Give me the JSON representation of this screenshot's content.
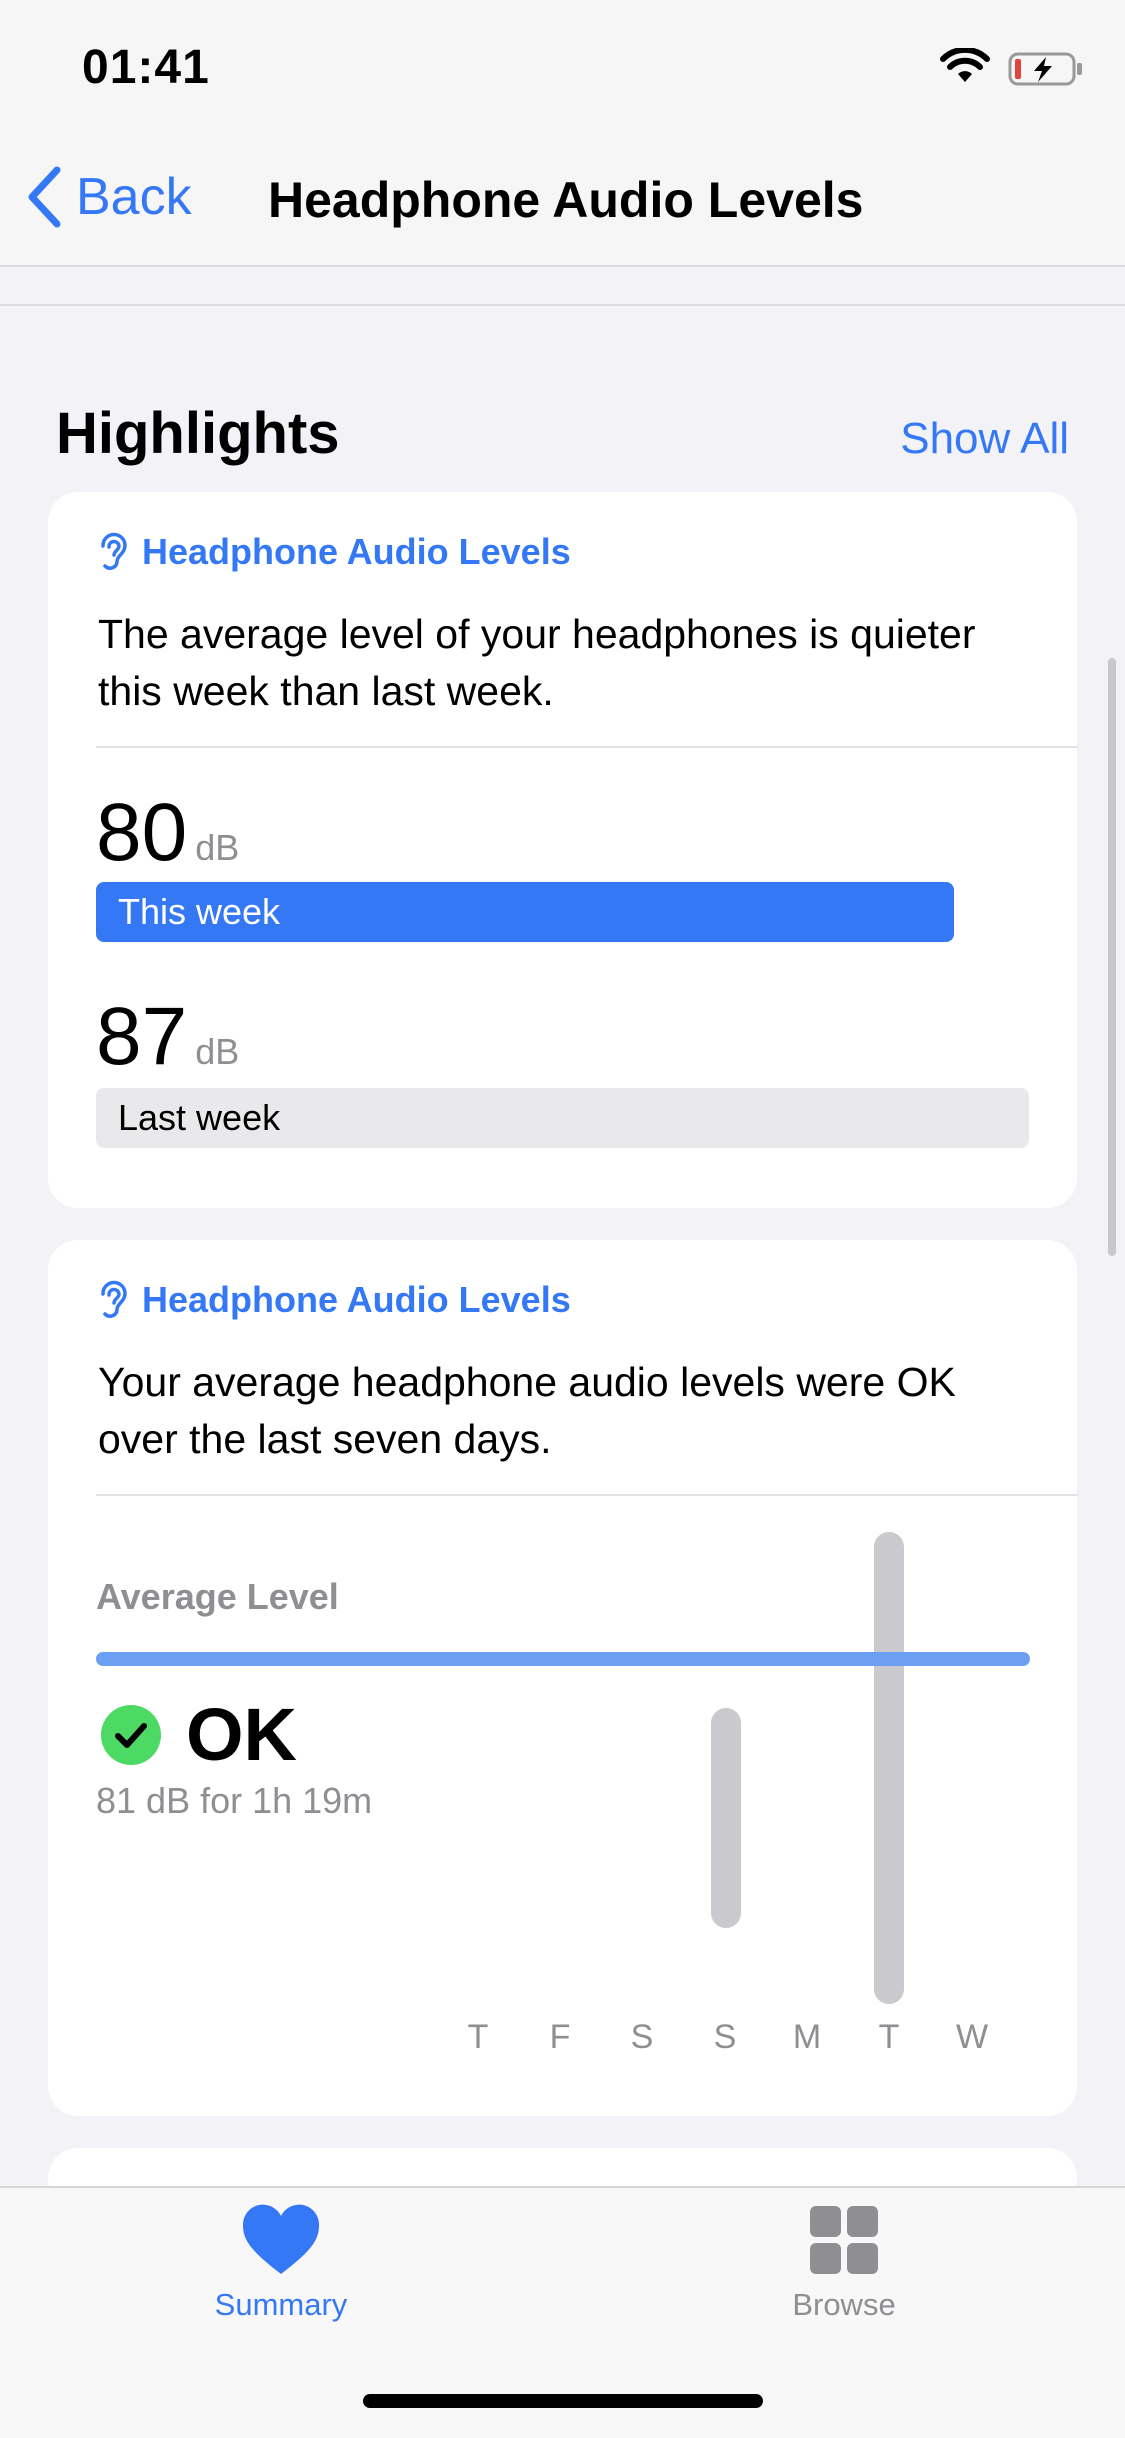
{
  "status": {
    "time": "01:41"
  },
  "nav": {
    "back_label": "Back",
    "title": "Headphone Audio Levels"
  },
  "highlights": {
    "heading": "Highlights",
    "show_all": "Show All"
  },
  "card1": {
    "label": "Headphone Audio Levels",
    "text": "The average level of your headphones is quieter this week than last week.",
    "this_week": {
      "value": "80",
      "unit": "dB",
      "label": "This week",
      "fraction": 0.92
    },
    "last_week": {
      "value": "87",
      "unit": "dB",
      "label": "Last week",
      "fraction": 1.0
    }
  },
  "card2": {
    "label": "Headphone Audio Levels",
    "text": "Your average headphone audio levels were OK over the last seven days.",
    "avg_label": "Average Level",
    "status": "OK",
    "detail": "81 dB for 1h 19m",
    "days": [
      "T",
      "F",
      "S",
      "S",
      "M",
      "T",
      "W"
    ]
  },
  "tabs": [
    {
      "label": "Summary",
      "icon": "heart-icon",
      "active": true,
      "color": "#3478f6"
    },
    {
      "label": "Browse",
      "icon": "grid-icon",
      "active": false,
      "color": "#8e8e93"
    }
  ],
  "colors": {
    "accent": "#3478f6",
    "ok_green": "#4cd964"
  }
}
